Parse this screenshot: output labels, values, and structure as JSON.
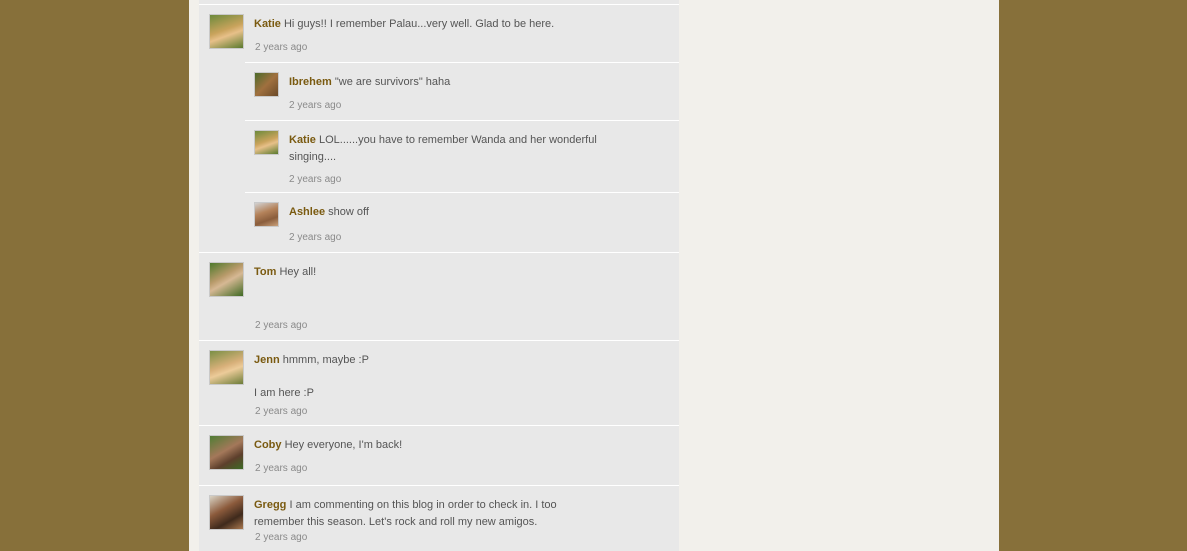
{
  "comments": [
    {
      "id": "katie-1",
      "author": "Katie",
      "text": "Hi guys!!  I remember Palau...very well.  Glad to be here.",
      "time": "2 years ago",
      "avatar_icon": "avatar-katie"
    },
    {
      "id": "ibrehem-reply",
      "author": "Ibrehem",
      "text": "\"we are survivors\" haha",
      "time": "2 years ago",
      "avatar_icon": "avatar-ibrehem"
    },
    {
      "id": "katie-reply",
      "author": "Katie",
      "text": "LOL......you have to remember Wanda and her wonderful singing....",
      "time": "2 years ago",
      "avatar_icon": "avatar-katie"
    },
    {
      "id": "ashlee-reply",
      "author": "Ashlee",
      "text": "show off",
      "time": "2 years ago",
      "avatar_icon": "avatar-ashlee"
    },
    {
      "id": "tom",
      "author": "Tom",
      "text": "Hey all!",
      "time": "2 years ago",
      "avatar_icon": "avatar-tom"
    },
    {
      "id": "jenn",
      "author": "Jenn",
      "text": "hmmm, maybe :P",
      "extra": "I am here :P",
      "time": "2 years ago",
      "avatar_icon": "avatar-jenn"
    },
    {
      "id": "coby",
      "author": "Coby",
      "text": "Hey everyone, I'm back!",
      "time": "2 years ago",
      "avatar_icon": "avatar-coby"
    },
    {
      "id": "gregg",
      "author": "Gregg",
      "text": "I am commenting on this blog in order to check in.  I too remember this season.  Let's rock and roll my new amigos.",
      "time": "2 years ago",
      "avatar_icon": "avatar-gregg"
    }
  ]
}
